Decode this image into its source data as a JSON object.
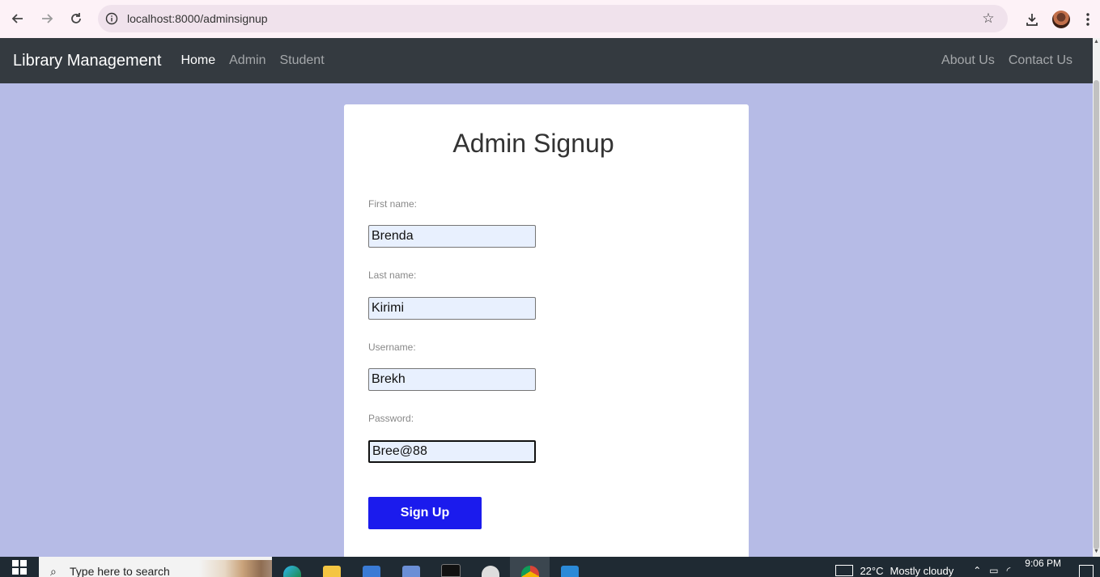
{
  "browser": {
    "url": "localhost:8000/adminsignup"
  },
  "navbar": {
    "brand": "Library Management",
    "left_links": [
      "Home",
      "Admin",
      "Student"
    ],
    "right_links": [
      "About Us",
      "Contact Us"
    ],
    "active_link": "Home"
  },
  "form": {
    "title": "Admin Signup",
    "fields": [
      {
        "label": "First name:",
        "value": "Brenda"
      },
      {
        "label": "Last name:",
        "value": "Kirimi"
      },
      {
        "label": "Username:",
        "value": "Brekh"
      },
      {
        "label": "Password:",
        "value": "Bree@88"
      }
    ],
    "submit_label": "Sign Up"
  },
  "taskbar": {
    "search_placeholder": "Type here to search",
    "temperature": "22°C",
    "weather": "Mostly cloudy",
    "time": "9:06 PM",
    "apps": [
      "edge-icon",
      "file-explorer-icon",
      "store-icon",
      "notepad-icon",
      "terminal-icon",
      "github-icon",
      "chrome-icon",
      "vscode-icon"
    ]
  },
  "colors": {
    "page_background": "#b6bbe6",
    "navbar": "#343a40",
    "button": "#1b1bed",
    "input_fill": "#e8f0fe"
  }
}
